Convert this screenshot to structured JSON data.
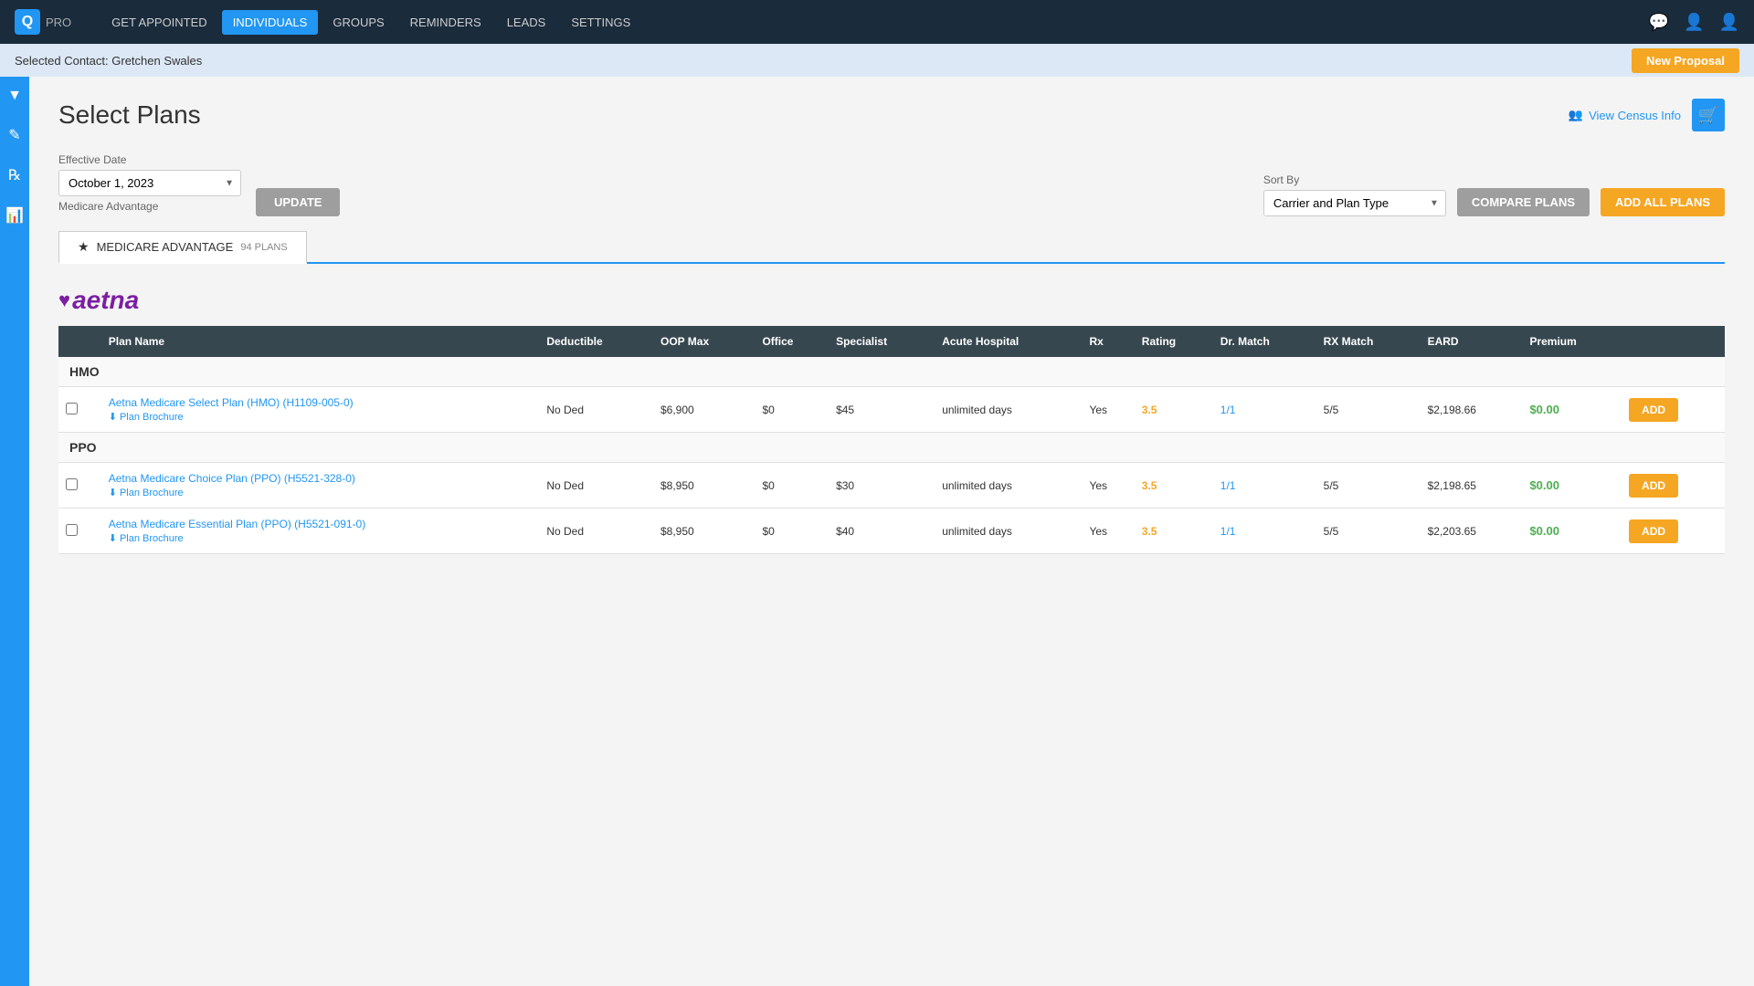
{
  "app": {
    "logo_letter": "Q",
    "logo_text": "PRO"
  },
  "nav": {
    "items": [
      {
        "label": "GET APPOINTED",
        "active": false
      },
      {
        "label": "INDIVIDUALS",
        "active": true
      },
      {
        "label": "GROUPS",
        "active": false
      },
      {
        "label": "REMINDERS",
        "active": false
      },
      {
        "label": "LEADS",
        "active": false
      },
      {
        "label": "SETTINGS",
        "active": false
      }
    ]
  },
  "contact_bar": {
    "label": "Selected Contact:",
    "contact_name": "Gretchen Swales",
    "new_proposal_label": "New Proposal"
  },
  "page": {
    "title": "Select Plans",
    "view_census_label": "View Census Info"
  },
  "filters": {
    "effective_date_label": "Effective Date",
    "effective_date_value": "October 1, 2023",
    "update_label": "UPDATE",
    "plan_type_label": "Medicare Advantage",
    "sort_by_label": "Sort By",
    "sort_by_value": "Carrier and Plan Type",
    "compare_plans_label": "COMPARE PLANS",
    "add_all_plans_label": "ADD ALL PLANS"
  },
  "tabs": [
    {
      "icon": "★",
      "label": "MEDICARE ADVANTAGE",
      "count": "94 PLANS",
      "active": true
    }
  ],
  "table": {
    "columns": [
      "Plan Name",
      "Deductible",
      "OOP Max",
      "Office",
      "Specialist",
      "Acute Hospital",
      "Rx",
      "Rating",
      "Dr. Match",
      "RX Match",
      "EARD",
      "Premium",
      ""
    ],
    "carrier": {
      "name": "aetna",
      "display": "♥aetna"
    },
    "sections": [
      {
        "type": "HMO",
        "plans": [
          {
            "name": "Aetna Medicare Select Plan (HMO) (H1109-005-0)",
            "brochure": "Plan Brochure",
            "deductible": "No Ded",
            "oop_max": "$6,900",
            "office": "$0",
            "specialist": "$45",
            "acute_hospital": "unlimited days",
            "rx": "Yes",
            "rating": "3.5",
            "dr_match": "1/1",
            "rx_match": "5/5",
            "eard": "$2,198.66",
            "premium": "$0.00"
          }
        ]
      },
      {
        "type": "PPO",
        "plans": [
          {
            "name": "Aetna Medicare Choice Plan (PPO) (H5521-328-0)",
            "brochure": "Plan Brochure",
            "deductible": "No Ded",
            "oop_max": "$8,950",
            "office": "$0",
            "specialist": "$30",
            "acute_hospital": "unlimited days",
            "rx": "Yes",
            "rating": "3.5",
            "dr_match": "1/1",
            "rx_match": "5/5",
            "eard": "$2,198.65",
            "premium": "$0.00"
          },
          {
            "name": "Aetna Medicare Essential Plan (PPO) (H5521-091-0)",
            "brochure": "Plan Brochure",
            "deductible": "No Ded",
            "oop_max": "$8,950",
            "office": "$0",
            "specialist": "$40",
            "acute_hospital": "unlimited days",
            "rx": "Yes",
            "rating": "3.5",
            "dr_match": "1/1",
            "rx_match": "5/5",
            "eard": "$2,203.65",
            "premium": "$0.00"
          }
        ]
      }
    ]
  },
  "sidebar": {
    "icons": [
      "▼",
      "✎",
      "℞",
      "📊"
    ]
  }
}
